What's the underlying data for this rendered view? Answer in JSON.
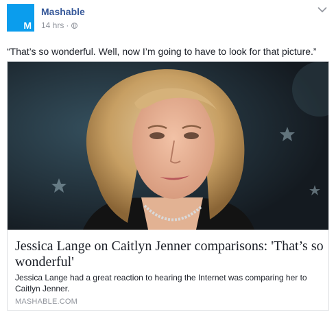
{
  "post": {
    "page_name": "Mashable",
    "avatar_letter": "M",
    "timestamp": "14 hrs",
    "separator": "·",
    "privacy_icon": "globe-icon",
    "menu_icon": "chevron-down-icon",
    "message": "“That’s so wonderful. Well, now I’m going to have to look for that picture.”"
  },
  "link": {
    "title": "Jessica Lange on Caitlyn Jenner comparisons: 'That’s so wonderful'",
    "description": "Jessica Lange had a great reaction to hearing the Internet was comparing her to Caitlyn Jenner.",
    "domain": "MASHABLE.COM",
    "image_icon": "portrait-photo"
  },
  "colors": {
    "brand": "#0b9ded",
    "page_name": "#365899",
    "meta_text": "#90949c",
    "border": "#dddfe2"
  }
}
